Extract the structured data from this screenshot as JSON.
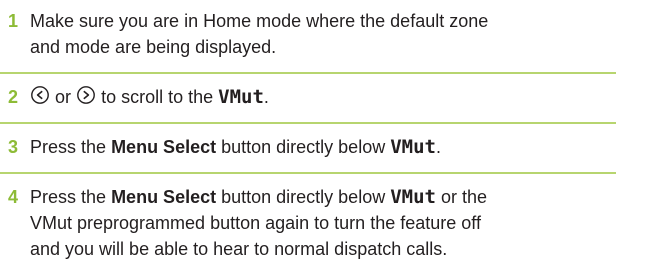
{
  "accent_color": "#8dbb36",
  "rule_color": "#b7d56f",
  "steps": [
    {
      "number": "1",
      "line1": "Make sure you are in Home mode where the default zone",
      "line2": "and mode are being displayed."
    },
    {
      "number": "2",
      "left_icon": "left-arrow-key-icon",
      "or_text": "or",
      "right_icon": "right-arrow-key-icon",
      "text": "to scroll to the",
      "target": "VMut",
      "end": "."
    },
    {
      "number": "3",
      "pre": "Press the",
      "bold": "Menu Select",
      "mid": "button directly below",
      "target": "VMut",
      "end": "."
    },
    {
      "number": "4",
      "pre": "Press the",
      "bold": "Menu Select",
      "mid": "button directly below",
      "target": "VMut",
      "post": "or the",
      "line2": "VMut preprogrammed button again to turn the feature off",
      "line3": "and you will be able to hear to normal dispatch calls."
    }
  ]
}
